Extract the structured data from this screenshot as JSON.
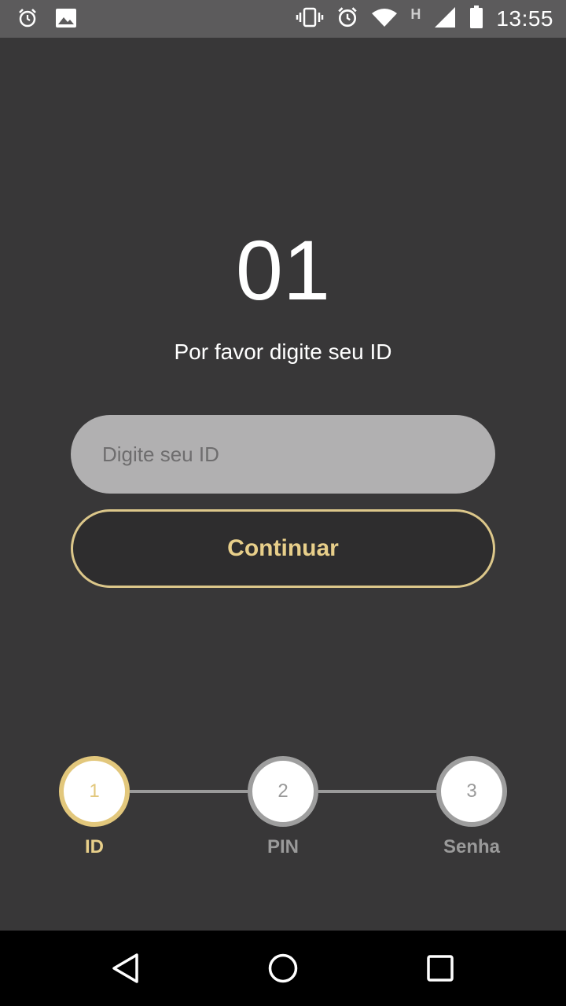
{
  "status_bar": {
    "time": "13:55",
    "network_label": "H",
    "left_icons": [
      "alarm-icon",
      "image-icon"
    ],
    "right_icons": [
      "vibrate-icon",
      "alarm-icon",
      "wifi-icon",
      "signal-icon",
      "battery-icon"
    ]
  },
  "main": {
    "step_number": "01",
    "instruction": "Por favor digite seu ID",
    "id_input": {
      "placeholder": "Digite seu ID",
      "value": ""
    },
    "continue_label": "Continuar"
  },
  "stepper": {
    "steps": [
      {
        "number": "1",
        "label": "ID",
        "active": true
      },
      {
        "number": "2",
        "label": "PIN",
        "active": false
      },
      {
        "number": "3",
        "label": "Senha",
        "active": false
      }
    ]
  },
  "nav_bar": {
    "buttons": [
      "back-icon",
      "home-icon",
      "recents-icon"
    ]
  },
  "colors": {
    "background": "#383738",
    "accent": "#e2c77c",
    "input_bg": "#b1b0b1",
    "inactive": "#9a9a9a"
  }
}
